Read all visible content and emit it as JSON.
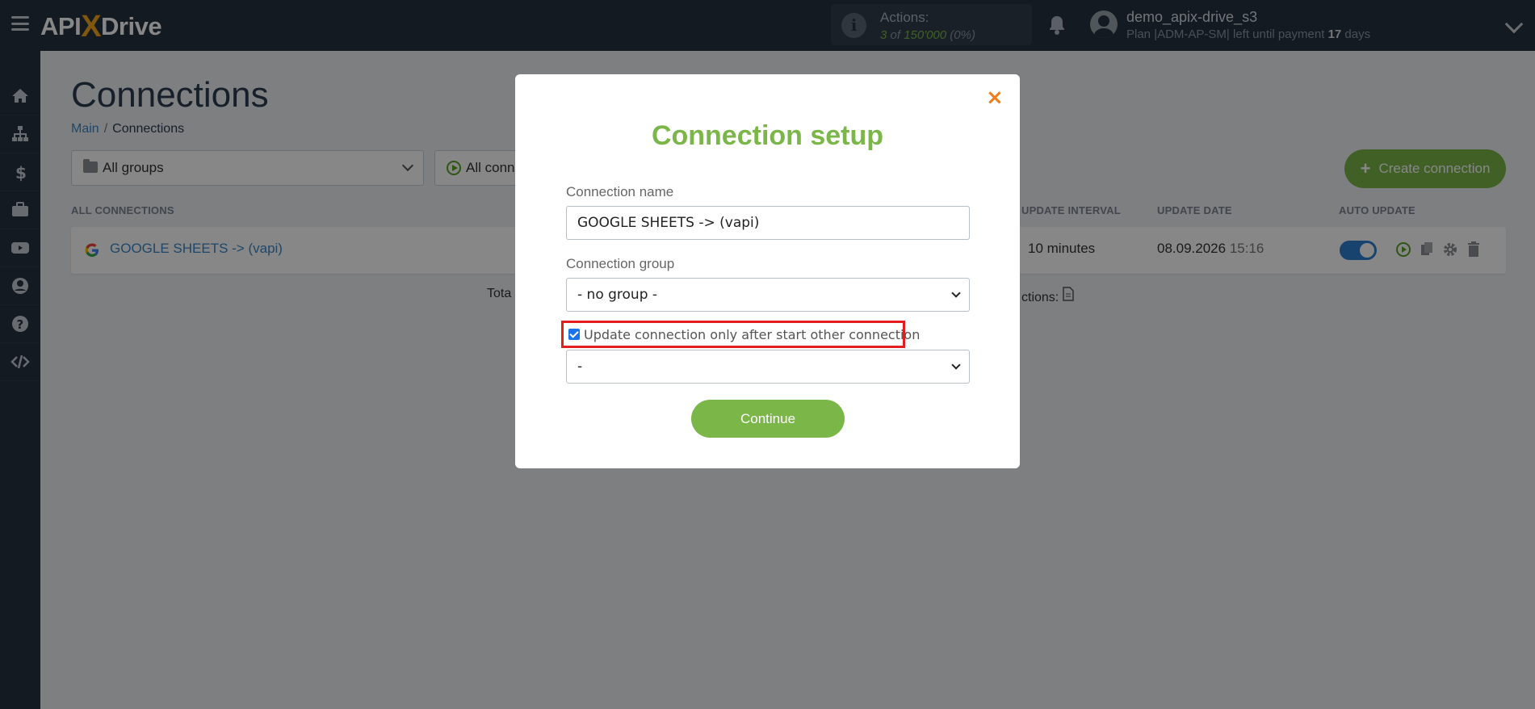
{
  "header": {
    "logo_api": "API",
    "logo_x": "X",
    "logo_drive": "Drive",
    "actions_label": "Actions:",
    "actions_used": "3",
    "actions_of": "of",
    "actions_total": "150'000",
    "actions_pct": "(0%)",
    "user_name": "demo_apix-drive_s3",
    "plan_prefix": "Plan |ADM-AP-SM| left until payment",
    "plan_days": "17",
    "plan_suffix": "days"
  },
  "sidebar": {
    "items": [
      "home-icon",
      "sitemap-icon",
      "dollar-icon",
      "briefcase-icon",
      "youtube-icon",
      "user-icon",
      "help-icon",
      "code-icon"
    ]
  },
  "main": {
    "title": "Connections",
    "breadcrumb_main": "Main",
    "breadcrumb_sep": "/",
    "breadcrumb_current": "Connections",
    "group_filter": "All groups",
    "status_filter": "All conn",
    "create_button": "Create connection",
    "columns": {
      "all": "ALL CONNECTIONS",
      "interval": "UPDATE INTERVAL",
      "date": "UPDATE DATE",
      "auto": "AUTO UPDATE"
    },
    "row": {
      "name": "GOOGLE SHEETS -> (vapi)",
      "interval": "10 minutes",
      "date": "08.09.2026",
      "time": "15:16",
      "auto_update": true
    },
    "totals_left": "Tota",
    "totals_right": "ctions:"
  },
  "modal": {
    "title": "Connection setup",
    "name_label": "Connection name",
    "name_value": "GOOGLE SHEETS -> (vapi)",
    "group_label": "Connection group",
    "group_value": "- no group -",
    "checkbox_label": "Update connection only after start other connection",
    "checkbox_checked": true,
    "dependency_value": "-",
    "continue_button": "Continue",
    "close": "×"
  },
  "colors": {
    "accent_green": "#7ab648",
    "nav_dark": "#263140",
    "link_blue": "#3b87c8",
    "close_orange": "#f07c1a",
    "highlight_red": "#e31e1e"
  }
}
